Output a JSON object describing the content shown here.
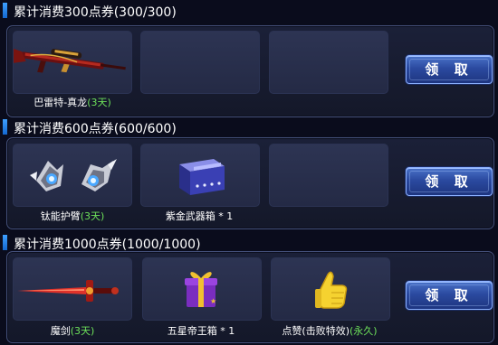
{
  "sections": [
    {
      "title": "累计消费300点券(300/300)",
      "claim_label": "领 取",
      "rewards": [
        {
          "name": "巴雷特-真龙",
          "suffix": "(3天)",
          "icon": "sniper-rifle-icon"
        }
      ]
    },
    {
      "title": "累计消费600点券(600/600)",
      "claim_label": "领 取",
      "rewards": [
        {
          "name": "钛能护臂",
          "suffix": "(3天)",
          "icon": "armguard-icon"
        },
        {
          "name": "紫金武器箱 * 1",
          "suffix": "",
          "icon": "weapon-box-icon"
        }
      ]
    },
    {
      "title": "累计消费1000点券(1000/1000)",
      "claim_label": "领 取",
      "rewards": [
        {
          "name": "魔剑",
          "suffix": "(3天)",
          "icon": "sword-icon"
        },
        {
          "name": "五星帝王箱 * 1",
          "suffix": "",
          "icon": "gift-box-icon"
        },
        {
          "name": "点赞(击败特效)",
          "suffix": "(永久)",
          "icon": "thumbs-up-icon"
        }
      ]
    }
  ],
  "colors": {
    "accent_green": "#6de15a",
    "button_blue": "#2b4aa0"
  }
}
